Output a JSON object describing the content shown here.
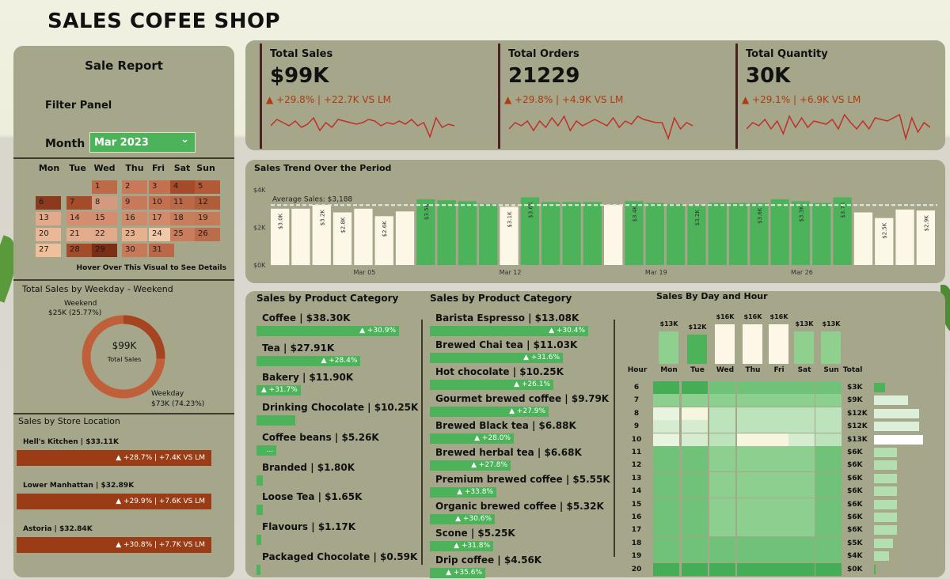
{
  "app_title": "SALES COFEE SHOP",
  "filter": {
    "report_title": "Sale Report",
    "panel_label": "Filter Panel",
    "month_label": "Month",
    "month_value": "Mar 2023"
  },
  "calendar": {
    "headers": [
      "Mon",
      "Tue",
      "Wed",
      "Thu",
      "Fri",
      "Sat",
      "Sun"
    ],
    "weeks": [
      [
        "",
        "",
        "1",
        "2",
        "3",
        "4",
        "5"
      ],
      [
        "6",
        "7",
        "8",
        "9",
        "10",
        "11",
        "12"
      ],
      [
        "13",
        "14",
        "15",
        "16",
        "17",
        "18",
        "19"
      ],
      [
        "20",
        "21",
        "22",
        "23",
        "24",
        "25",
        "26"
      ],
      [
        "27",
        "28",
        "29",
        "30",
        "31",
        "",
        ""
      ]
    ],
    "colors": [
      [
        "",
        "",
        "#bd6a47",
        "#c7795a",
        "#c3704f",
        "#a44b2a",
        "#b25a38"
      ],
      [
        "#8b3a1e",
        "#a44b2a",
        "#d49a80",
        "#c7795a",
        "#c3704f",
        "#ba6847",
        "#b05d3a"
      ],
      [
        "#e2a98a",
        "#d48e6f",
        "#d48e6f",
        "#cf8a6a",
        "#d18b6a",
        "#c87d5d",
        "#c67a58"
      ],
      [
        "#eab898",
        "#e3ac8b",
        "#e2a98a",
        "#e6b18f",
        "#f0c9a8",
        "#c87d5d",
        "#bb6d4b"
      ],
      [
        "#f0bf9b",
        "#a44b2a",
        "#7b2f14",
        "#c67a58",
        "#ba6847",
        "",
        ""
      ]
    ],
    "note": "Hover Over This Visual to See Details"
  },
  "weekday_weekend": {
    "title": "Total Sales by Weekday - Weekend",
    "weekend_label": "Weekend",
    "weekend_value": "$25K (25.77%)",
    "weekday_label": "Weekday",
    "weekday_value": "$73K (74.23%)",
    "weekend_pct": 25.77,
    "total": "$99K",
    "total_label": "Total Sales",
    "colors": [
      "#c0603a",
      "#a54420"
    ]
  },
  "store_location": {
    "title": "Sales by Store Location",
    "stores": [
      {
        "label": "Hell's Kitchen | $33.11K",
        "delta": "▲ +28.7% | +7.4K VS LM"
      },
      {
        "label": "Lower Manhattan | $32.89K",
        "delta": "▲ +29.9% | +7.6K VS LM"
      },
      {
        "label": "Astoria | $32.84K",
        "delta": "▲ +30.8% | +7.7K VS LM"
      }
    ]
  },
  "kpis": [
    {
      "title": "Total Sales",
      "value": "$99K",
      "delta": "▲ +29.8% | +22.7K VS LM",
      "spark": [
        22,
        26,
        24,
        22,
        25,
        21,
        23,
        27,
        19,
        24,
        21,
        26,
        25,
        24,
        23,
        24,
        26,
        25,
        22,
        24,
        23,
        25,
        23,
        26,
        22,
        24,
        15,
        27,
        21,
        23,
        22
      ]
    },
    {
      "title": "Total Orders",
      "value": "21229",
      "delta": "▲ +29.8% | +4.9K VS LM",
      "spark": [
        20,
        24,
        22,
        25,
        19,
        25,
        21,
        27,
        22,
        28,
        19,
        25,
        22,
        24,
        26,
        24,
        22,
        27,
        21,
        25,
        23,
        28,
        26,
        25,
        24,
        24,
        14,
        27,
        20,
        24,
        22
      ]
    },
    {
      "title": "Total Quantity",
      "value": "30K",
      "delta": "▲ +29.1% | +6.9K VS LM",
      "spark": [
        20,
        24,
        22,
        26,
        20,
        25,
        17,
        28,
        21,
        27,
        21,
        25,
        24,
        23,
        26,
        20,
        29,
        24,
        20,
        25,
        20,
        27,
        26,
        25,
        27,
        29,
        14,
        27,
        18,
        24,
        21
      ]
    }
  ],
  "chart_data": {
    "type": "bar",
    "title": "Sales Trend Over the Period",
    "average_label": "Average Sales: $3,188",
    "average": 3188,
    "ylim": [
      0,
      4000
    ],
    "yticks": [
      "$0K",
      "$2K",
      "$4K"
    ],
    "xticks": [
      {
        "label": "Mar 05",
        "index": 4
      },
      {
        "label": "Mar 12",
        "index": 11
      },
      {
        "label": "Mar 19",
        "index": 18
      },
      {
        "label": "Mar 26",
        "index": 25
      }
    ],
    "values": [
      3000,
      3000,
      3200,
      2800,
      3000,
      2600,
      2850,
      3500,
      3450,
      3400,
      3250,
      3100,
      3600,
      3350,
      3350,
      3350,
      3200,
      3400,
      3300,
      3250,
      3200,
      3300,
      3300,
      3300,
      3500,
      3400,
      3300,
      3600,
      2800,
      2500,
      2950,
      2900
    ],
    "above_average": [
      false,
      false,
      false,
      false,
      false,
      false,
      false,
      true,
      true,
      true,
      true,
      false,
      true,
      true,
      true,
      true,
      false,
      true,
      true,
      true,
      true,
      true,
      true,
      true,
      true,
      true,
      true,
      true,
      false,
      false,
      false,
      false
    ],
    "data_labels": [
      "$3.0K",
      "",
      "$3.2K",
      "$2.8K",
      "",
      "$2.6K",
      "",
      "$3.5K",
      "",
      "",
      "",
      "$3.1K",
      "$3.6K",
      "",
      "",
      "",
      "",
      "$3.4K",
      "",
      "",
      "$3.2K",
      "",
      "",
      "$3.6K",
      "",
      "$3.3K",
      "",
      "$3.7K",
      "",
      "$2.5K",
      "",
      "$2.9K"
    ],
    "colors": {
      "above": "#4cb35a",
      "below": "#fcf7e6"
    }
  },
  "product_category": {
    "title": "Sales by Product Category",
    "items": [
      {
        "label": "Coffee | $38.30K",
        "pct": "▲ +30.9%",
        "share": 1.0
      },
      {
        "label": "Tea | $27.91K",
        "pct": "▲ +28.4%",
        "share": 0.73
      },
      {
        "label": "Bakery | $11.90K",
        "pct": "▲ +31.7%",
        "share": 0.31
      },
      {
        "label": "Drinking Chocolate | $10.25K",
        "pct": "",
        "share": 0.27
      },
      {
        "label": "Coffee beans | $5.26K",
        "pct": "...",
        "share": 0.14
      },
      {
        "label": "Branded | $1.80K",
        "pct": "",
        "share": 0.047
      },
      {
        "label": "Loose Tea | $1.65K",
        "pct": "",
        "share": 0.043
      },
      {
        "label": "Flavours | $1.17K",
        "pct": "",
        "share": 0.031
      },
      {
        "label": "Packaged Chocolate | $0.59K",
        "pct": "",
        "share": 0.015
      }
    ]
  },
  "product_type": {
    "title": "Sales by Product Category",
    "items": [
      {
        "label": "Barista Espresso | $13.08K",
        "pct": "▲ +30.4%",
        "share": 1.0
      },
      {
        "label": "Brewed Chai tea | $11.03K",
        "pct": "▲ +31.6%",
        "share": 0.84
      },
      {
        "label": "Hot chocolate | $10.25K",
        "pct": "▲ +26.1%",
        "share": 0.78
      },
      {
        "label": "Gourmet brewed coffee | $9.79K",
        "pct": "▲ +27.9%",
        "share": 0.75
      },
      {
        "label": "Brewed Black tea | $6.88K",
        "pct": "▲ +28.0%",
        "share": 0.53
      },
      {
        "label": "Brewed herbal tea | $6.68K",
        "pct": "▲ +27.8%",
        "share": 0.51
      },
      {
        "label": "Premium brewed coffee | $5.55K",
        "pct": "▲ +33.8%",
        "share": 0.42
      },
      {
        "label": "Organic brewed coffee | $5.32K",
        "pct": "▲ +30.6%",
        "share": 0.41
      },
      {
        "label": "Scone | $5.25K",
        "pct": "▲ +31.8%",
        "share": 0.4
      },
      {
        "label": "Drip coffee | $4.56K",
        "pct": "▲ +35.6%",
        "share": 0.35
      }
    ]
  },
  "day_hour": {
    "title": "Sales By Day and Hour",
    "hour_label": "Hour",
    "total_label": "Total",
    "days": [
      "Mon",
      "Tue",
      "Wed",
      "Thu",
      "Fri",
      "Sat",
      "Sun"
    ],
    "day_totals": [
      "$13K",
      "$12K",
      "$16K",
      "$16K",
      "$16K",
      "$13K",
      "$13K"
    ],
    "day_values": [
      13,
      12,
      16,
      16,
      16,
      13,
      13
    ],
    "hours": [
      "6",
      "7",
      "8",
      "9",
      "10",
      "11",
      "12",
      "13",
      "14",
      "15",
      "16",
      "17",
      "18",
      "19",
      "20"
    ],
    "hour_totals": [
      "$3K",
      "$9K",
      "$12K",
      "$12K",
      "$13K",
      "$6K",
      "$6K",
      "$6K",
      "$6K",
      "$6K",
      "$6K",
      "$6K",
      "$5K",
      "$4K",
      "$0K"
    ],
    "hour_values": [
      3,
      9,
      12,
      12,
      13,
      6,
      6,
      6,
      6,
      6,
      6,
      6,
      5,
      4,
      0.3
    ],
    "grid": [
      [
        2,
        2,
        3,
        3,
        3,
        3,
        3
      ],
      [
        4,
        4,
        4,
        4,
        4,
        4,
        4
      ],
      [
        8,
        9,
        6,
        6,
        6,
        6,
        6
      ],
      [
        7,
        7,
        6,
        6,
        6,
        6,
        6
      ],
      [
        8,
        7,
        6,
        9,
        9,
        7,
        6
      ],
      [
        3,
        3,
        4,
        4,
        4,
        4,
        3
      ],
      [
        3,
        3,
        4,
        4,
        4,
        4,
        3
      ],
      [
        3,
        3,
        4,
        4,
        4,
        4,
        3
      ],
      [
        3,
        3,
        4,
        4,
        4,
        4,
        3
      ],
      [
        3,
        3,
        4,
        4,
        4,
        4,
        3
      ],
      [
        3,
        3,
        4,
        4,
        4,
        4,
        3
      ],
      [
        3,
        3,
        4,
        4,
        4,
        4,
        3
      ],
      [
        3,
        3,
        3,
        3,
        3,
        3,
        3
      ],
      [
        3,
        3,
        3,
        3,
        3,
        3,
        3
      ],
      [
        2,
        2,
        2,
        2,
        2,
        2,
        2
      ]
    ]
  }
}
